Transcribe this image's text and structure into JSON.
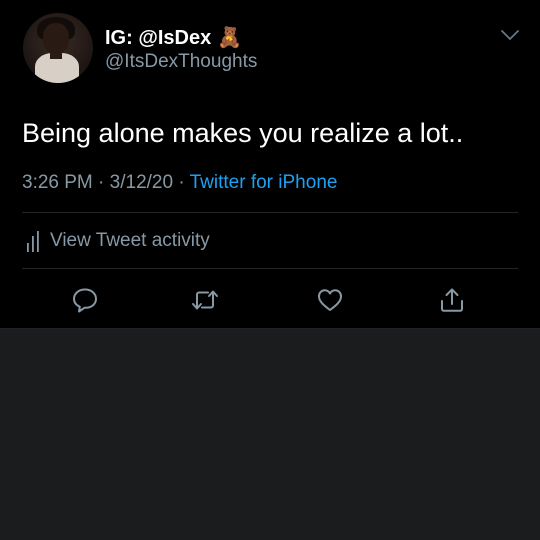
{
  "tweet": {
    "display_name": "IG: @IsDex",
    "display_name_emoji": "🧸",
    "handle": "@ItsDexThoughts",
    "text": "Being alone makes you realize a lot..",
    "time": "3:26 PM",
    "date": "3/12/20",
    "separator": "·",
    "source": "Twitter for iPhone",
    "activity_label": "View Tweet activity"
  },
  "icons": {
    "menu": "chevron-down-icon",
    "activity": "bar-chart-icon",
    "reply": "speech-bubble-icon",
    "retweet": "retweet-icon",
    "like": "heart-icon",
    "share": "share-icon"
  },
  "colors": {
    "background": "#000000",
    "text": "#ffffff",
    "secondary": "#8899a6",
    "link": "#1da1f2",
    "below_area": "#1b1c1e"
  }
}
